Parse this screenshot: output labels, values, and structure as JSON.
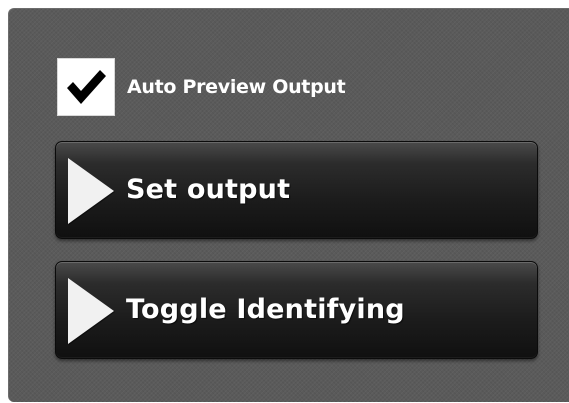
{
  "auto_preview": {
    "label": "Auto Preview Output",
    "checked": true,
    "icon": "checkmark-icon"
  },
  "buttons": [
    {
      "label": "Set output",
      "icon": "play-icon"
    },
    {
      "label": "Toggle Identifying",
      "icon": "play-icon"
    }
  ],
  "colors": {
    "panel_background": "#5a5a5a",
    "button_background": "#1c1c1c",
    "text": "#ffffff",
    "checkbox_background": "#ffffff",
    "checkmark": "#000000"
  }
}
